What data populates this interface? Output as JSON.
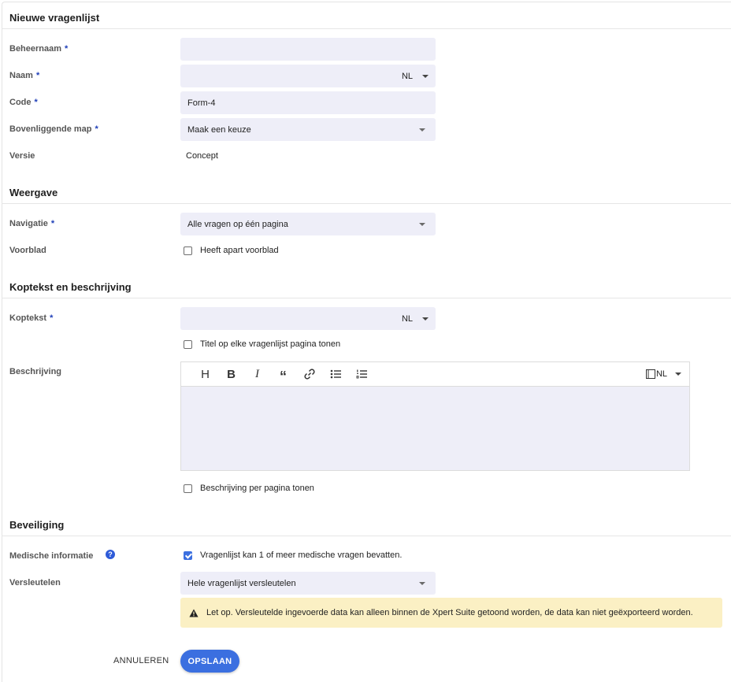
{
  "sections": {
    "general": "Nieuwe vragenlijst",
    "display": "Weergave",
    "header": "Koptekst en beschrijving",
    "security": "Beveiliging"
  },
  "required_mark": "*",
  "fields": {
    "admin_name": {
      "label": "Beheernaam",
      "value": ""
    },
    "name": {
      "label": "Naam",
      "value": "",
      "lang": "NL"
    },
    "code": {
      "label": "Code",
      "value": "Form-4"
    },
    "parent_folder": {
      "label": "Bovenliggende map",
      "value": "Maak een keuze"
    },
    "version": {
      "label": "Versie",
      "value": "Concept"
    },
    "navigation": {
      "label": "Navigatie",
      "value": "Alle vragen op één pagina"
    },
    "cover": {
      "label": "Voorblad",
      "checkbox_label": "Heeft apart voorblad",
      "checked": false
    },
    "header_text": {
      "label": "Koptekst",
      "value": "",
      "lang": "NL"
    },
    "title_each_page": {
      "checkbox_label": "Titel op elke vragenlijst pagina tonen",
      "checked": false
    },
    "description": {
      "label": "Beschrijving",
      "lang": "NL",
      "toolbar": [
        "heading-icon",
        "bold-icon",
        "italic-icon",
        "quote-icon",
        "link-icon",
        "bullet-list-icon",
        "numbered-list-icon"
      ],
      "toolbar_glyphs": {
        "heading": "H",
        "bold": "B",
        "italic": "I",
        "quote": "“"
      }
    },
    "description_per_page": {
      "checkbox_label": "Beschrijving per pagina tonen",
      "checked": false
    },
    "medical": {
      "label": "Medische informatie",
      "help": "?",
      "checkbox_label": "Vragenlijst kan 1 of meer medische vragen bevatten.",
      "checked": true
    },
    "encrypt": {
      "label": "Versleutelen",
      "value": "Hele vragenlijst versleutelen"
    }
  },
  "warning": {
    "icon": "warning-icon",
    "text": "Let op. Versleutelde ingevoerde data kan alleen binnen de Xpert Suite getoond worden, de data kan niet geëxporteerd worden."
  },
  "actions": {
    "cancel": "ANNULEREN",
    "save": "OPSLAAN"
  },
  "colors": {
    "accent": "#3b6fe0",
    "input_bg": "#eeeef8",
    "warning_bg": "#fbf0c4",
    "required": "#1f3fb8"
  }
}
